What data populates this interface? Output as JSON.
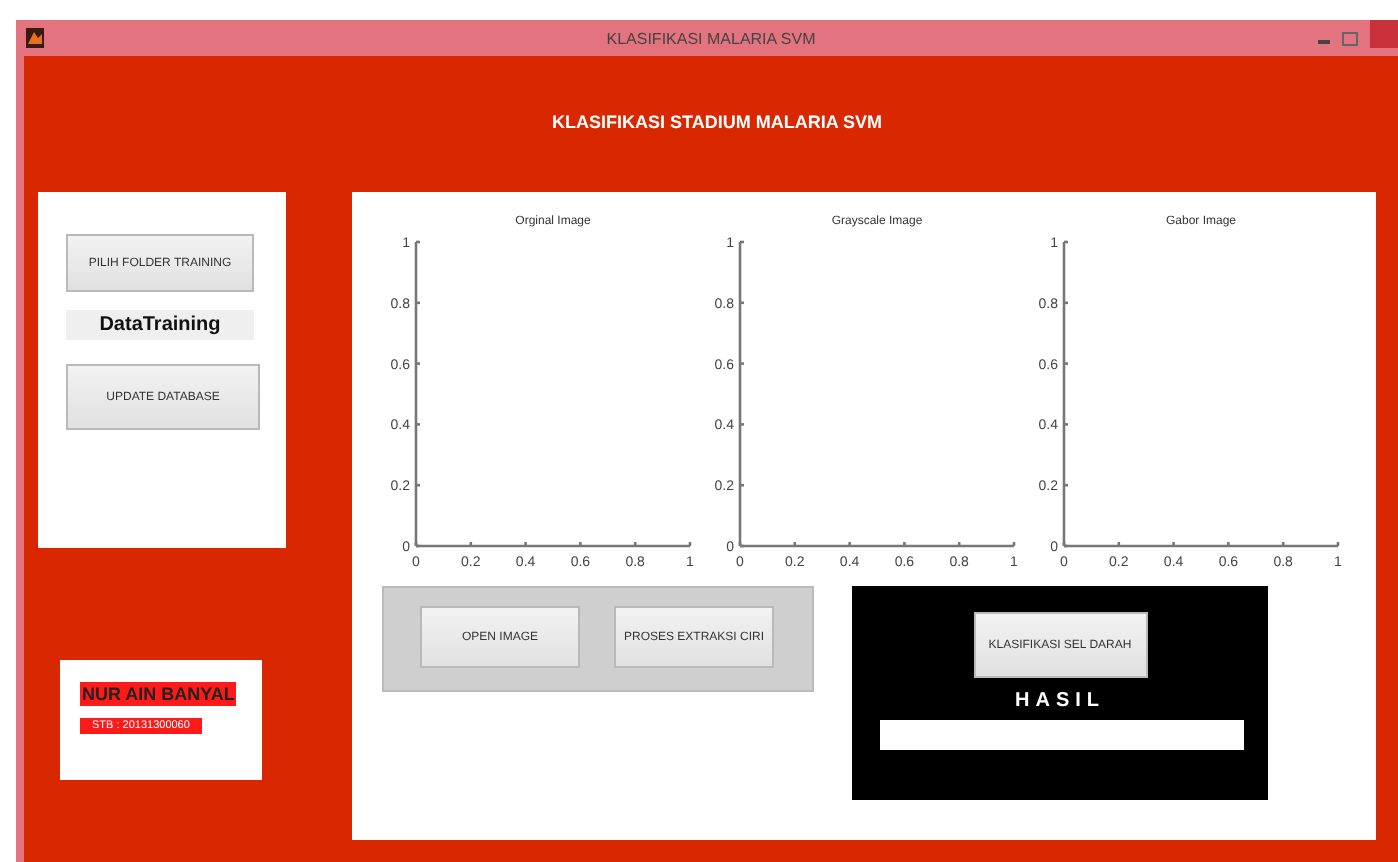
{
  "window": {
    "title": "KLASIFIKASI MALARIA SVM"
  },
  "header": "KLASIFIKASI STADIUM  MALARIA SVM",
  "training_panel": {
    "folder_button": "PILIH FOLDER  TRAINING",
    "data_label": "DataTraining",
    "update_button": "UPDATE DATABASE"
  },
  "author": {
    "name": "NUR AIN BANYAL",
    "id": "STB : 20131300060"
  },
  "charts": [
    {
      "chart_data": {
        "type": "line",
        "title": "Orginal Image",
        "xlim": [
          0,
          1
        ],
        "ylim": [
          0,
          1
        ],
        "xticks": [
          0,
          0.2,
          0.4,
          0.6,
          0.8,
          1
        ],
        "yticks": [
          0,
          0.2,
          0.4,
          0.6,
          0.8,
          1
        ]
      }
    },
    {
      "chart_data": {
        "type": "line",
        "title": "Grayscale Image",
        "xlim": [
          0,
          1
        ],
        "ylim": [
          0,
          1
        ],
        "xticks": [
          0,
          0.2,
          0.4,
          0.6,
          0.8,
          1
        ],
        "yticks": [
          0,
          0.2,
          0.4,
          0.6,
          0.8,
          1
        ]
      }
    },
    {
      "chart_data": {
        "type": "line",
        "title": "Gabor  Image",
        "xlim": [
          0,
          1
        ],
        "ylim": [
          0,
          1
        ],
        "xticks": [
          0,
          0.2,
          0.4,
          0.6,
          0.8,
          1
        ],
        "yticks": [
          0,
          0.2,
          0.4,
          0.6,
          0.8,
          1
        ]
      }
    }
  ],
  "image_panel": {
    "buttons": [
      "OPEN IMAGE",
      "PROSES EXTRAKSI CIRI"
    ]
  },
  "result_panel": {
    "button": "KLASIFIKASI SEL DARAH",
    "label": "HASIL"
  }
}
